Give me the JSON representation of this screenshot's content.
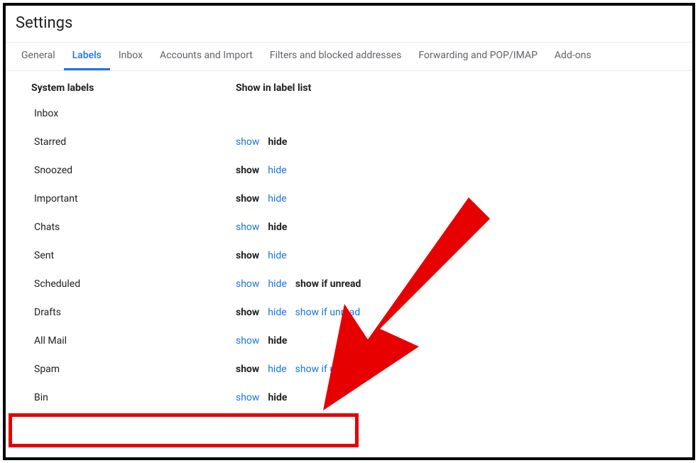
{
  "pageTitle": "Settings",
  "tabs": [
    {
      "label": "General",
      "active": false
    },
    {
      "label": "Labels",
      "active": true
    },
    {
      "label": "Inbox",
      "active": false
    },
    {
      "label": "Accounts and Import",
      "active": false
    },
    {
      "label": "Filters and blocked addresses",
      "active": false
    },
    {
      "label": "Forwarding and POP/IMAP",
      "active": false
    },
    {
      "label": "Add-ons",
      "active": false
    }
  ],
  "headers": {
    "systemLabels": "System labels",
    "showInList": "Show in label list"
  },
  "labels": [
    {
      "name": "Inbox",
      "options": []
    },
    {
      "name": "Starred",
      "options": [
        {
          "text": "show",
          "style": "link"
        },
        {
          "text": "hide",
          "style": "bold"
        }
      ]
    },
    {
      "name": "Snoozed",
      "options": [
        {
          "text": "show",
          "style": "bold"
        },
        {
          "text": "hide",
          "style": "link"
        }
      ]
    },
    {
      "name": "Important",
      "options": [
        {
          "text": "show",
          "style": "bold"
        },
        {
          "text": "hide",
          "style": "link"
        }
      ]
    },
    {
      "name": "Chats",
      "options": [
        {
          "text": "show",
          "style": "link"
        },
        {
          "text": "hide",
          "style": "bold"
        }
      ]
    },
    {
      "name": "Sent",
      "options": [
        {
          "text": "show",
          "style": "bold"
        },
        {
          "text": "hide",
          "style": "link"
        }
      ]
    },
    {
      "name": "Scheduled",
      "options": [
        {
          "text": "show",
          "style": "link"
        },
        {
          "text": "hide",
          "style": "link"
        },
        {
          "text": "show if unread",
          "style": "bold"
        }
      ]
    },
    {
      "name": "Drafts",
      "options": [
        {
          "text": "show",
          "style": "bold"
        },
        {
          "text": "hide",
          "style": "link"
        },
        {
          "text": "show if unread",
          "style": "link"
        }
      ]
    },
    {
      "name": "All Mail",
      "options": [
        {
          "text": "show",
          "style": "link"
        },
        {
          "text": "hide",
          "style": "bold"
        }
      ]
    },
    {
      "name": "Spam",
      "options": [
        {
          "text": "show",
          "style": "bold"
        },
        {
          "text": "hide",
          "style": "link"
        },
        {
          "text": "show if unread",
          "style": "link"
        }
      ]
    },
    {
      "name": "Bin",
      "options": [
        {
          "text": "show",
          "style": "link"
        },
        {
          "text": "hide",
          "style": "bold"
        }
      ]
    }
  ]
}
